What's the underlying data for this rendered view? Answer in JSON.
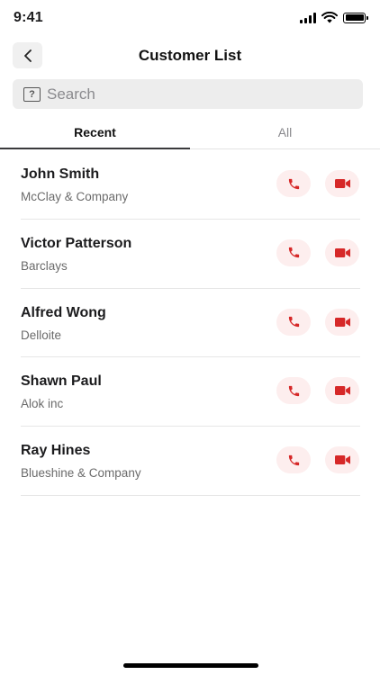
{
  "status_bar": {
    "time": "9:41"
  },
  "header": {
    "title": "Customer List"
  },
  "search": {
    "placeholder": "Search",
    "icon_glyph": "?"
  },
  "tabs": [
    {
      "label": "Recent",
      "active": true
    },
    {
      "label": "All",
      "active": false
    }
  ],
  "customers": [
    {
      "name": "John Smith",
      "company": "McClay & Company"
    },
    {
      "name": "Victor Patterson",
      "company": "Barclays"
    },
    {
      "name": "Alfred Wong",
      "company": "Delloite"
    },
    {
      "name": "Shawn Paul",
      "company": "Alok inc"
    },
    {
      "name": "Ray Hines",
      "company": "Blueshine & Company"
    }
  ],
  "icons": {
    "call": "phone-icon",
    "video": "video-camera-icon",
    "back": "chevron-left-icon"
  },
  "colors": {
    "accent": "#d62828",
    "accent_bg": "#fdeeee"
  }
}
